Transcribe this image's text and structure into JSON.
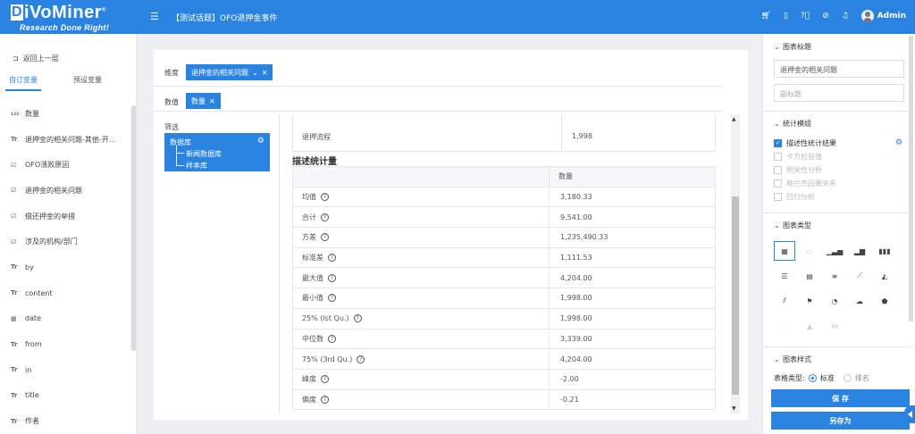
{
  "app": {
    "logo_text": "iVoMiner",
    "logo_letter": "D",
    "logo_reg": "®",
    "logo_tagline": "Research Done Right!",
    "page_title": "【测试话题】OFO退押金事件",
    "user": "Admin"
  },
  "left": {
    "back": "返回上一层",
    "tabs": [
      "自订变量",
      "预设变量"
    ],
    "variables": [
      {
        "icon": "123",
        "label": "数量"
      },
      {
        "icon": "Tr",
        "label": "退押金的相关问题-其他-开..."
      },
      {
        "icon": "☑",
        "label": "OFO溃败原因"
      },
      {
        "icon": "☑",
        "label": "退押金的相关问题"
      },
      {
        "icon": "☑",
        "label": "偿还押金的举措"
      },
      {
        "icon": "☑",
        "label": "涉及的机构/部门"
      },
      {
        "icon": "Tr",
        "label": "by"
      },
      {
        "icon": "Tr",
        "label": "content"
      },
      {
        "icon": "▦",
        "label": "date"
      },
      {
        "icon": "Tr",
        "label": "from"
      },
      {
        "icon": "Tr",
        "label": "in"
      },
      {
        "icon": "Tr",
        "label": "title"
      },
      {
        "icon": "Tr",
        "label": "作者"
      }
    ]
  },
  "main": {
    "dimension_label": "维度",
    "dimension_chip": "退押金的相关问题",
    "value_label": "数值",
    "value_chip": "数量",
    "filter_title": "筛选",
    "filter_db": "数据库",
    "filter_items": [
      "新闻数据库",
      "样本库"
    ],
    "prev_row": {
      "label": "退押流程",
      "value": "1,998"
    },
    "section_title": "描述统计量",
    "table_header": "数量",
    "stats": [
      {
        "label": "均值",
        "value": "3,180.33"
      },
      {
        "label": "合计",
        "value": "9,541.00"
      },
      {
        "label": "方差",
        "value": "1,235,490.33"
      },
      {
        "label": "标准差",
        "value": "1,111.53"
      },
      {
        "label": "最大值",
        "value": "4,204.00"
      },
      {
        "label": "最小值",
        "value": "1,998.00"
      },
      {
        "label": "25% (lst Qu.)",
        "value": "1,998.00"
      },
      {
        "label": "中位数",
        "value": "3,339.00"
      },
      {
        "label": "75% (3rd Qu.)",
        "value": "4,204.00"
      },
      {
        "label": "峰度",
        "value": "-2.00"
      },
      {
        "label": "偏度",
        "value": "-0.21"
      }
    ]
  },
  "right": {
    "chart_title_section": "图表标题",
    "title_value": "退押金的相关问题",
    "subtitle_placeholder": "副标题",
    "stat_module_section": "统计模组",
    "modules": [
      {
        "label": "描述性统计结果",
        "checked": true
      },
      {
        "label": "卡方检验值",
        "checked": false
      },
      {
        "label": "相关性分析",
        "checked": false
      },
      {
        "label": "格兰杰因果关系",
        "checked": false
      },
      {
        "label": "回归分析",
        "checked": false
      }
    ],
    "chart_type_section": "图表类型",
    "chart_style_section": "图表样式",
    "table_type_label": "表格类型:",
    "table_type_options": [
      "标准",
      "排名"
    ],
    "save": "保 存",
    "save_as": "另存为"
  }
}
